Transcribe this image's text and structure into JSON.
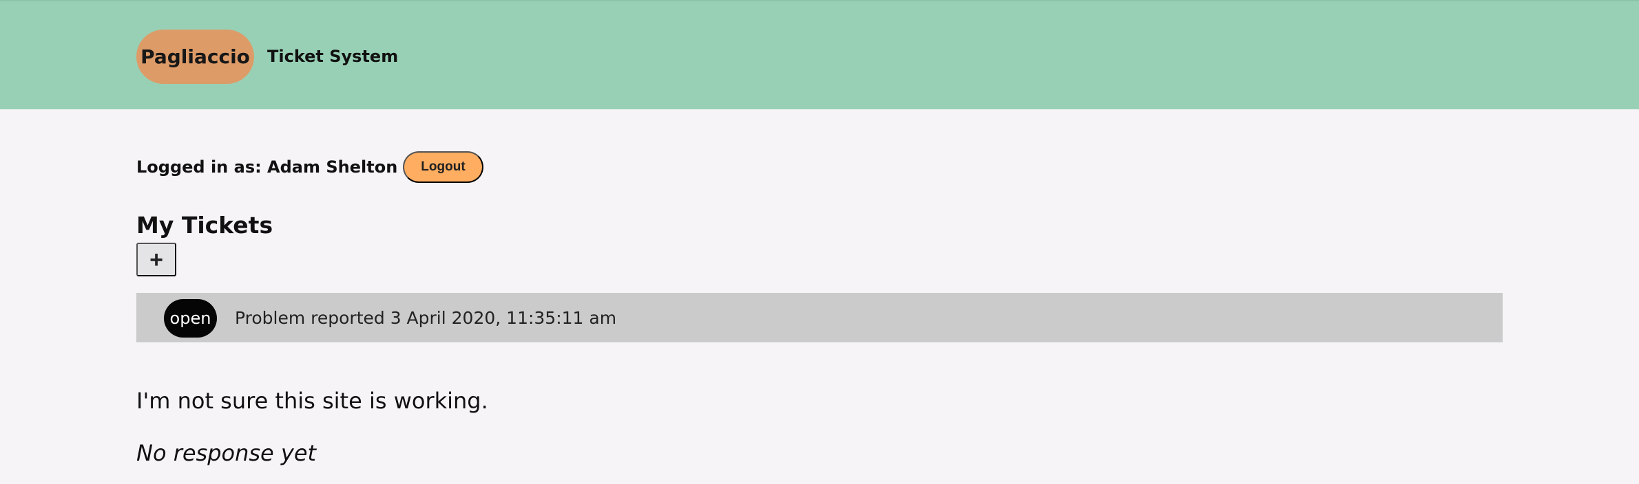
{
  "header": {
    "brand": "Pagliaccio",
    "app_title": "Ticket System"
  },
  "session": {
    "logged_in_label": "Logged in as: Adam Shelton",
    "logout_label": "Logout"
  },
  "page": {
    "title": "My Tickets",
    "add_button_label": "+"
  },
  "tickets": [
    {
      "status": "open",
      "meta": "Problem reported 3 April 2020, 11:35:11 am",
      "body": "I'm not sure this site is working.",
      "response": "No response yet"
    }
  ],
  "colors": {
    "header_bg": "#98d0b5",
    "brand_pill": "#dd9b68",
    "logout_button": "#ffad60",
    "ticket_row_bg": "#cbcbcb",
    "status_badge_bg": "#050505",
    "page_bg": "#f6f4f7"
  }
}
